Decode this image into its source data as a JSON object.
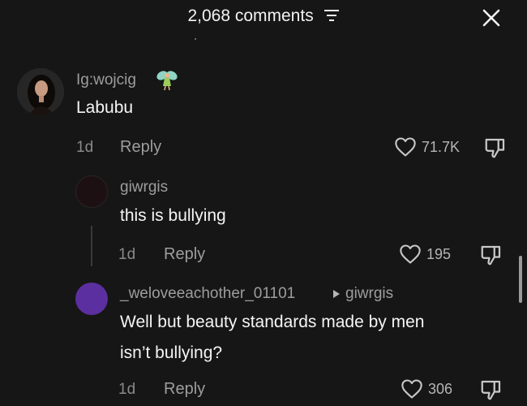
{
  "header": {
    "title": "2,068 comments",
    "filter_icon": "filter-icon",
    "close_icon": "close-icon"
  },
  "comments": [
    {
      "username": "Ig:wojcig",
      "badge_icon": "fairy-icon",
      "text": "Labubu",
      "time": "1d",
      "reply_label": "Reply",
      "likes": "71.7K"
    },
    {
      "username": "giwrgis",
      "text": "this is bullying",
      "time": "1d",
      "reply_label": "Reply",
      "likes": "195"
    },
    {
      "username": "_weloveeachother_01101",
      "reply_to": "giwrgis",
      "text_line1": "Well but beauty standards made by men",
      "text_line2": "isn’t bullying?",
      "time": "1d",
      "reply_label": "Reply",
      "likes": "306"
    }
  ],
  "colors": {
    "background": "#161616",
    "avatar_purple": "#5b2fa0",
    "avatar_dark": "#1c1012"
  }
}
